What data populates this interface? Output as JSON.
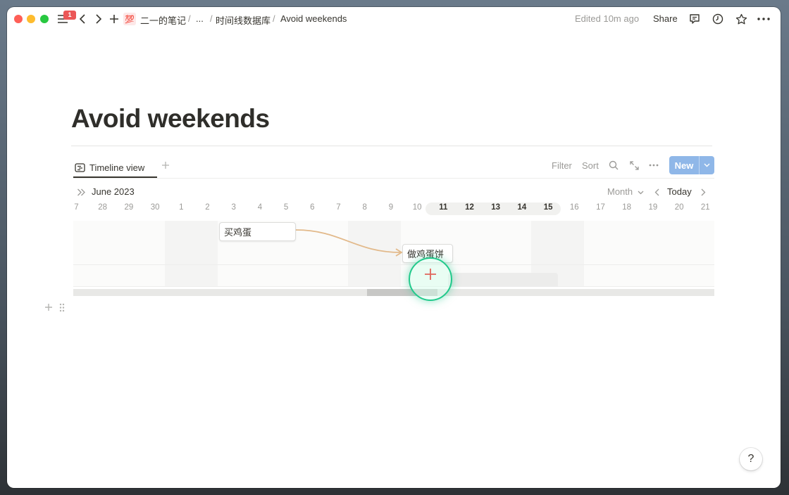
{
  "topbar": {
    "notification_count": "1",
    "page_emoji": "💯",
    "breadcrumbs": [
      "二一的笔记",
      "...",
      "时间线数据库",
      "Avoid weekends"
    ],
    "separator": "/",
    "edited": "Edited 10m ago",
    "share_label": "Share"
  },
  "page": {
    "title": "Avoid weekends"
  },
  "view": {
    "tab_label": "Timeline view",
    "filter_label": "Filter",
    "sort_label": "Sort",
    "new_label": "New"
  },
  "timeline": {
    "month_label": "June 2023",
    "scale_label": "Month",
    "today_label": "Today",
    "days": [
      "7",
      "28",
      "29",
      "30",
      "1",
      "2",
      "3",
      "4",
      "5",
      "6",
      "7",
      "8",
      "9",
      "10",
      "11",
      "12",
      "13",
      "14",
      "15",
      "16",
      "17",
      "18",
      "19",
      "20",
      "21"
    ],
    "highlighted_days": [
      "11",
      "12",
      "13",
      "14",
      "15"
    ],
    "items": [
      {
        "label": "买鸡蛋"
      },
      {
        "label": "做鸡蛋饼"
      }
    ]
  },
  "help_label": "?",
  "colors": {
    "accent": "#8fb7e8",
    "badge": "#eb5757",
    "cursor": "#21c98b",
    "dependency": "#e2b98a"
  }
}
